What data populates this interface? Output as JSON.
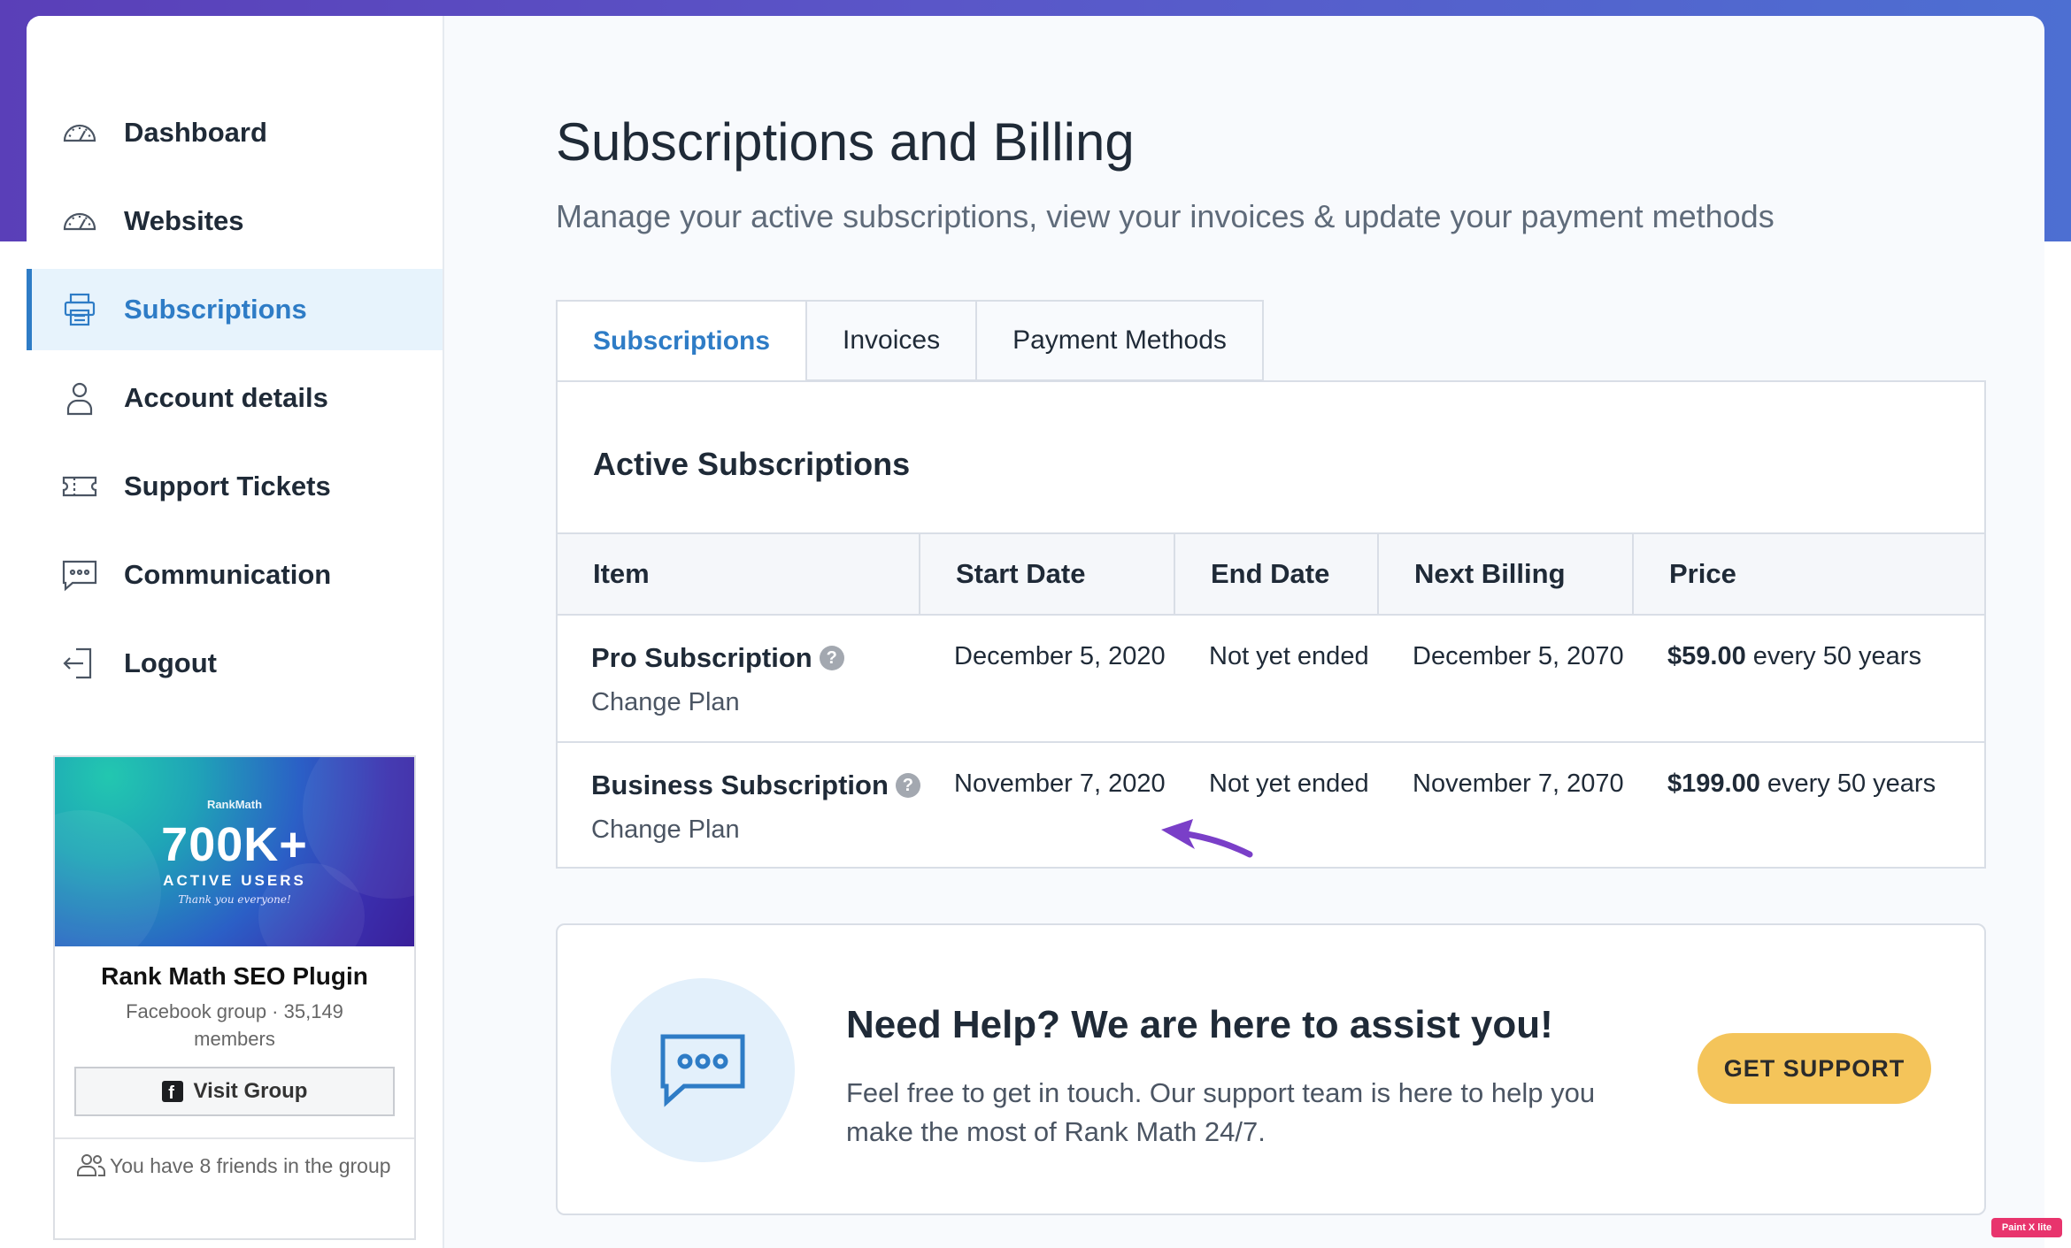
{
  "sidebar": {
    "items": [
      {
        "label": "Dashboard",
        "icon": "gauge-icon",
        "active": false
      },
      {
        "label": "Websites",
        "icon": "gauge-icon",
        "active": false
      },
      {
        "label": "Subscriptions",
        "icon": "printer-icon",
        "active": true
      },
      {
        "label": "Account details",
        "icon": "user-icon",
        "active": false
      },
      {
        "label": "Support Tickets",
        "icon": "ticket-icon",
        "active": false
      },
      {
        "label": "Communication",
        "icon": "chat-icon",
        "active": false
      },
      {
        "label": "Logout",
        "icon": "logout-icon",
        "active": false
      }
    ],
    "facebook_widget": {
      "banner_brand": "RankMath",
      "banner_big": "700K+",
      "banner_active": "ACTIVE USERS",
      "banner_thanks": "Thank you everyone!",
      "name": "Rank Math SEO Plugin",
      "meta": "Facebook group · 35,149 members",
      "button_label": "Visit Group",
      "friends_text": "You have 8 friends in the group"
    }
  },
  "main": {
    "title": "Subscriptions and Billing",
    "subtitle": "Manage your active subscriptions, view your invoices & update your payment methods",
    "tabs": [
      {
        "label": "Subscriptions",
        "active": true
      },
      {
        "label": "Invoices",
        "active": false
      },
      {
        "label": "Payment Methods",
        "active": false
      }
    ],
    "subscriptions": {
      "heading": "Active Subscriptions",
      "columns": [
        "Item",
        "Start Date",
        "End Date",
        "Next Billing",
        "Price"
      ],
      "rows": [
        {
          "item": "Pro Subscription",
          "action": "Change Plan",
          "start": "December 5, 2020",
          "end": "Not yet ended",
          "next": "December 5, 2070",
          "price_amount": "$59.00",
          "price_period": "every 50 years"
        },
        {
          "item": "Business Subscription",
          "action": "Change Plan",
          "start": "November 7, 2020",
          "end": "Not yet ended",
          "next": "November 7, 2070",
          "price_amount": "$199.00",
          "price_period": "every 50 years"
        }
      ],
      "help_badge": "?"
    },
    "help": {
      "title": "Need Help? We are here to assist you!",
      "text": "Feel free to get in touch. Our support team is here to help you make the most of Rank Math 24/7.",
      "button_label": "GET SUPPORT"
    }
  },
  "watermark": "Paint X lite",
  "colors": {
    "accent": "#2e7cc6",
    "support_button": "#f4c45a",
    "annotation_arrow": "#7a3fc8"
  }
}
